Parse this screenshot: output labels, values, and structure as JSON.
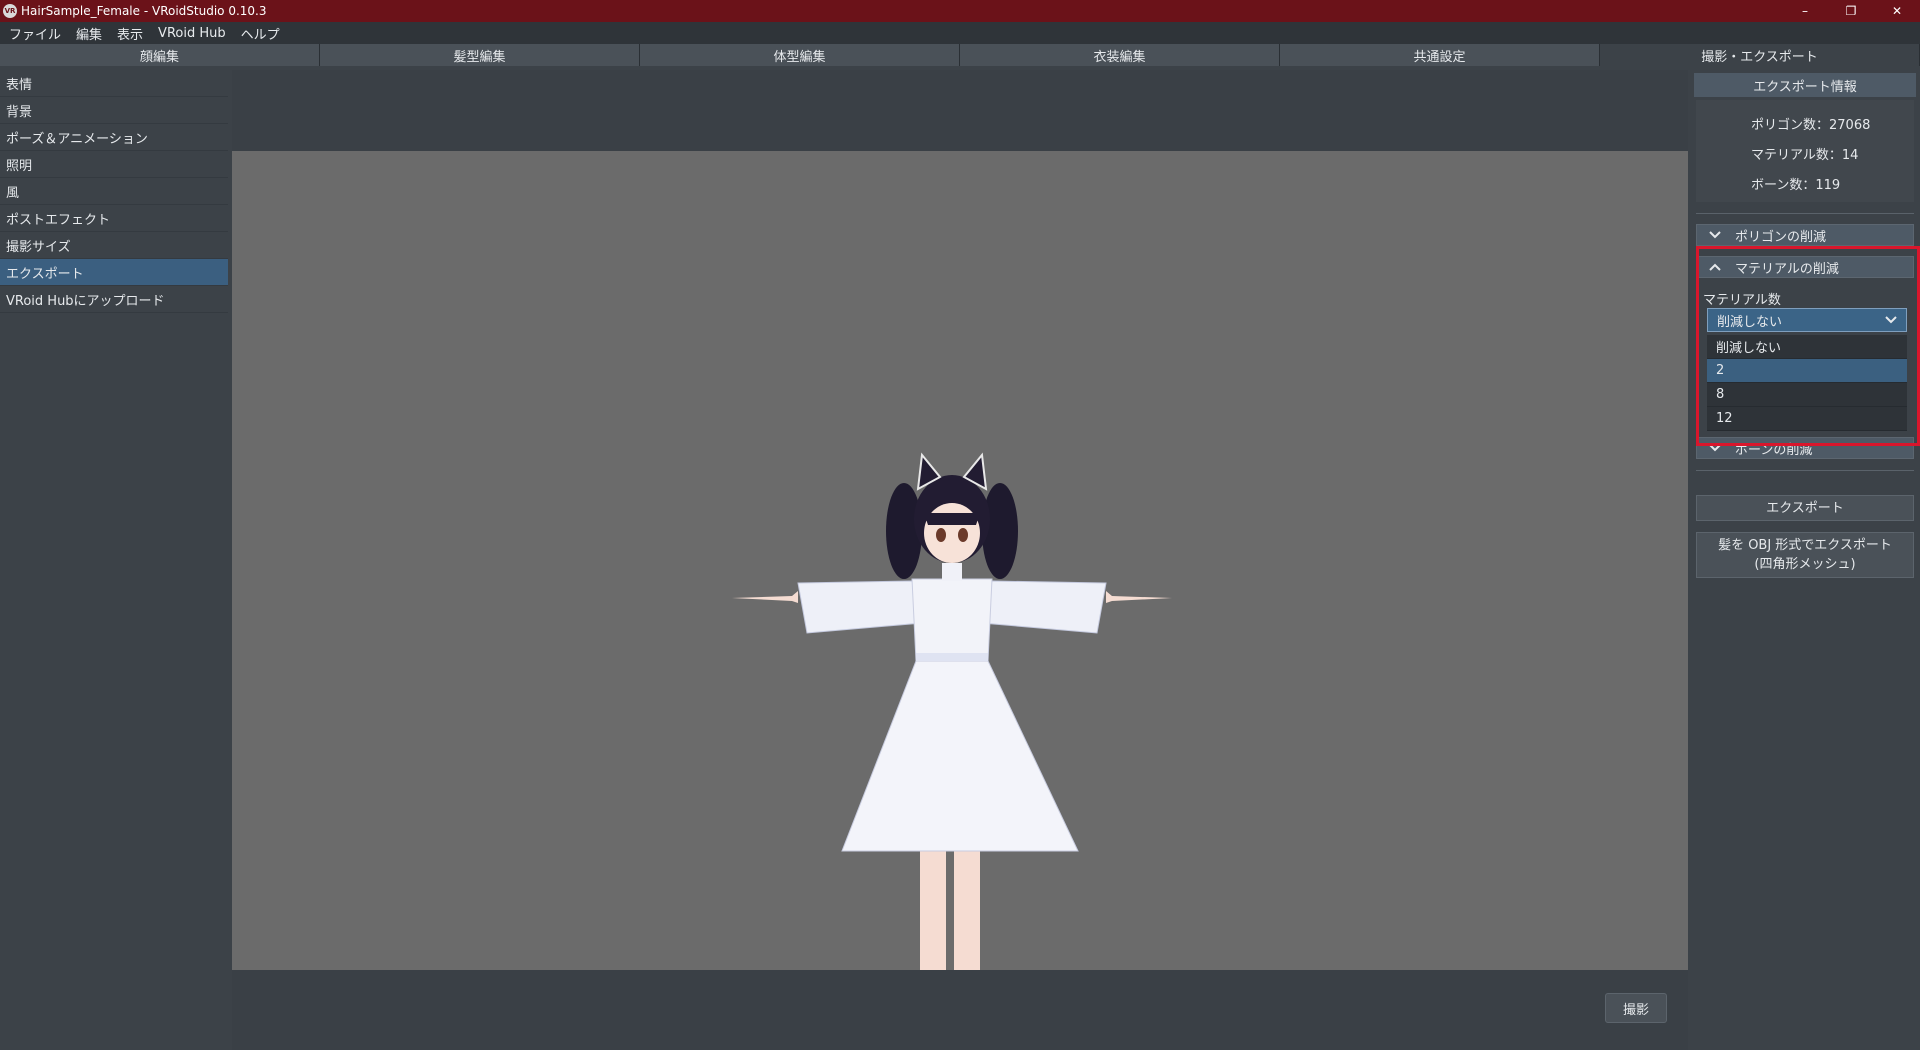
{
  "window": {
    "title": "HairSample_Female - VRoidStudio 0.10.3",
    "app_icon": "VR"
  },
  "window_controls": {
    "minimize": "–",
    "restore": "❐",
    "close": "✕"
  },
  "menu": [
    "ファイル",
    "編集",
    "表示",
    "VRoid Hub",
    "ヘルプ"
  ],
  "tabs": [
    "顔編集",
    "髪型編集",
    "体型編集",
    "衣装編集",
    "共通設定",
    "撮影・エクスポート"
  ],
  "left_nav": [
    "表情",
    "背景",
    "ポーズ＆アニメーション",
    "照明",
    "風",
    "ポストエフェクト",
    "撮影サイズ",
    "エクスポート",
    "VRoid Hubにアップロード"
  ],
  "right": {
    "header": "エクスポート情報",
    "polygons": "ポリゴン数：27068",
    "materials": "マテリアル数：14",
    "bones": "ボーン数：119",
    "sec_polygon": "ポリゴンの削減",
    "sec_material": "マテリアルの削減",
    "material_count_label": "マテリアル数",
    "select_value": "削減しない",
    "options": [
      "削減しない",
      "2",
      "8",
      "12"
    ],
    "sec_bone": "ボーンの削減",
    "export_button": "エクスポート",
    "obj_export_line1": "髪を OBJ 形式でエクスポート",
    "obj_export_line2": "(四角形メッシュ)"
  },
  "shoot_button": "撮影",
  "colors": {
    "titlebar": "#6b1219",
    "panel": "#3c4248",
    "viewport": "#6b6b6b",
    "accent": "#3b6487",
    "highlight_box": "#d9162c"
  }
}
